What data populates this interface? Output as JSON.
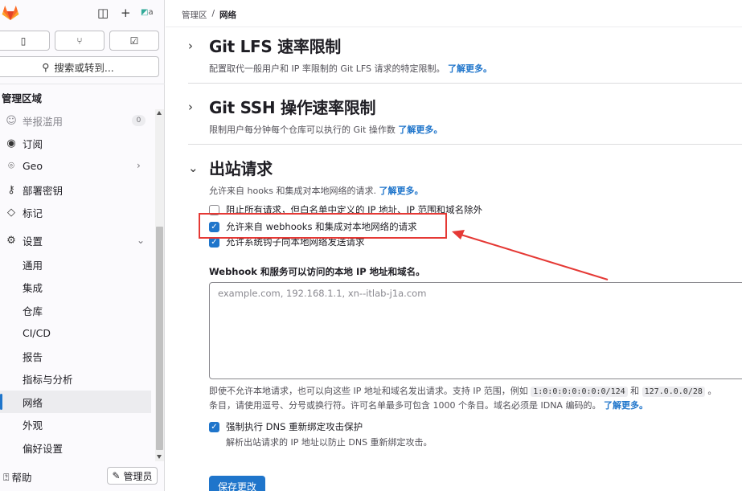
{
  "sidebar": {
    "avatar_text": "a",
    "search_label": "搜索或转到...",
    "section_title": "管理区域",
    "items": [
      {
        "icon": "abuse-report-icon",
        "glyph": "☺",
        "label": "举报滥用",
        "count": "0"
      },
      {
        "icon": "subscription-icon",
        "glyph": "◉",
        "label": "订阅"
      },
      {
        "icon": "location-icon",
        "glyph": "⌾",
        "label": "Geo",
        "chevron": "›"
      },
      {
        "icon": "key-icon",
        "glyph": "⚷",
        "label": "部署密钥"
      },
      {
        "icon": "label-icon",
        "glyph": "◇",
        "label": "标记"
      },
      {
        "icon": "gear-icon",
        "glyph": "⚙",
        "label": "设置",
        "chevron": "⌄"
      },
      {
        "label": "通用"
      },
      {
        "label": "集成"
      },
      {
        "label": "仓库"
      },
      {
        "label": "CI/CD"
      },
      {
        "label": "报告"
      },
      {
        "label": "指标与分析"
      },
      {
        "label": "网络"
      },
      {
        "label": "外观"
      },
      {
        "label": "偏好设置"
      }
    ],
    "help_label": "帮助",
    "admin_label": "管理员"
  },
  "breadcrumb": {
    "root": "管理区",
    "sep": "/",
    "current": "网络"
  },
  "sections": {
    "lfs": {
      "title": "Git LFS 速率限制",
      "desc": "配置取代一般用户和 IP 率限制的 Git LFS 请求的特定限制。",
      "link": "了解更多。"
    },
    "ssh": {
      "title": "Git SSH 操作速率限制",
      "desc": "限制用户每分钟每个仓库可以执行的 Git 操作数",
      "link": "了解更多。"
    },
    "outbound": {
      "title": "出站请求",
      "desc": "允许来自 hooks 和集成对本地网络的请求.",
      "link": "了解更多。"
    }
  },
  "checkboxes": [
    {
      "label": "阻止所有请求，但白名单中定义的 IP 地址、IP 范围和域名除外",
      "checked": false
    },
    {
      "label": "允许来自 webhooks 和集成对本地网络的请求",
      "checked": true
    },
    {
      "label": "允许系统钩子向本地网络发送请求",
      "checked": true
    }
  ],
  "allowlist": {
    "label": "Webhook 和服务可以访问的本地 IP 地址和域名。",
    "placeholder": "example.com, 192.168.1.1, xn--itlab-j1a.com",
    "help_a": "即使不允许本地请求，也可以向这些 IP 地址和域名发出请求。支持 IP 范围，例如",
    "code1": "1:0:0:0:0:0:0:0/124",
    "and": "和",
    "code2": "127.0.0.0/28",
    "help_b": "。",
    "help_c": "条目，请使用逗号、分号或换行符。许可名单最多可包含 1000 个条目。域名必须是 IDNA 编码的。",
    "link": "了解更多。"
  },
  "dns": {
    "title": "强制执行 DNS 重新绑定攻击保护",
    "desc": "解析出站请求的 IP 地址以防止 DNS 重新绑定攻击。",
    "checked": true
  },
  "save_label": "保存更改",
  "colors": {
    "accent": "#1f75cb",
    "highlight": "#e53935"
  }
}
